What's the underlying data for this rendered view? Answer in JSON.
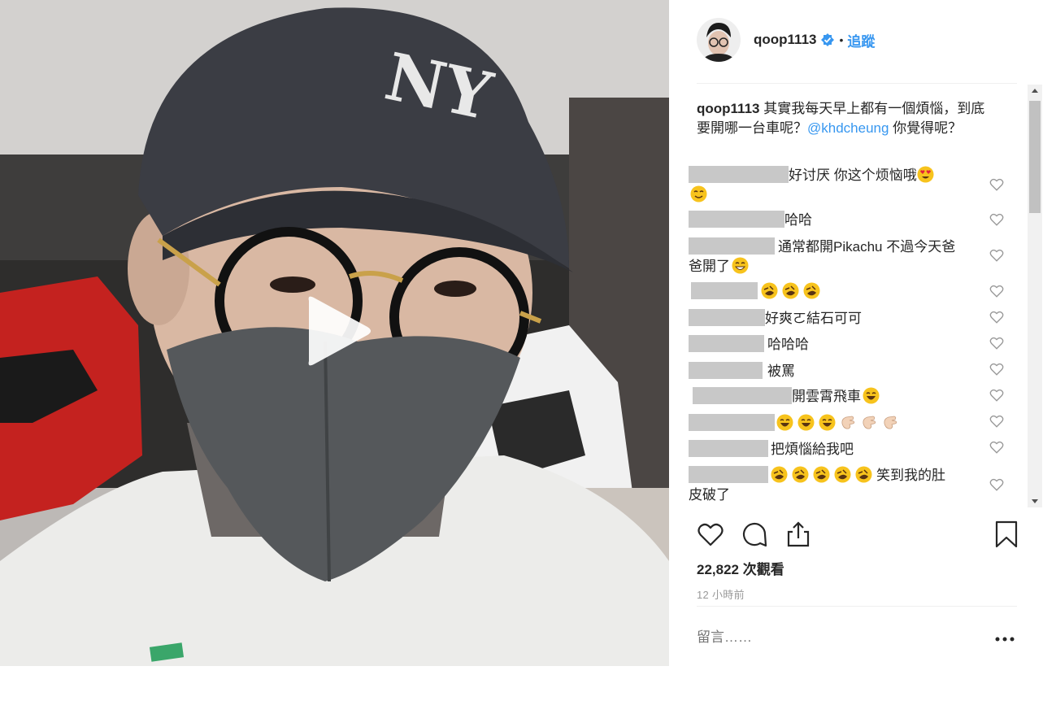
{
  "post": {
    "username": "qoop1113",
    "follow_label": "追蹤",
    "dot": "•",
    "caption_user": "qoop1113",
    "caption_text_1": " 其實我每天早上都有一個煩惱，到底要開哪一台車呢？",
    "caption_mention": "@khdcheung",
    "caption_text_2": " 你覺得呢？",
    "views": "22,822 次觀看",
    "time": "12 小時前",
    "comment_placeholder": "留言……"
  },
  "comments": [
    {
      "text": "好讨厌 你这个烦恼哦",
      "emoji": [
        "heart-eyes",
        "smile"
      ]
    },
    {
      "text": "哈哈",
      "emoji": []
    },
    {
      "text": "通常都開Pikachu 不過今天爸爸開了",
      "emoji": [
        "grin"
      ]
    },
    {
      "text": "",
      "emoji": [
        "rofl",
        "rofl",
        "rofl"
      ]
    },
    {
      "text": "好爽ㄛ結石可可",
      "emoji": []
    },
    {
      "text": "哈哈哈",
      "emoji": []
    },
    {
      "text": "被罵",
      "emoji": []
    },
    {
      "text": "開雲霄飛車",
      "emoji": [
        "laugh"
      ]
    },
    {
      "text": "",
      "emoji": [
        "laugh",
        "laugh",
        "laugh",
        "clap",
        "clap",
        "clap"
      ]
    },
    {
      "text": "把煩惱給我吧",
      "emoji": []
    },
    {
      "text": "笑到我的肚皮破了",
      "emoji": [
        "rofl",
        "rofl",
        "rofl",
        "rofl",
        "rofl"
      ]
    }
  ],
  "colors": {
    "link": "#3897f0",
    "verified": "#3897f0",
    "text": "#262626",
    "muted": "#999999"
  },
  "icons": [
    "play-icon",
    "verified-badge-icon",
    "heart-icon",
    "comment-icon",
    "share-icon",
    "bookmark-icon",
    "more-options-icon"
  ]
}
